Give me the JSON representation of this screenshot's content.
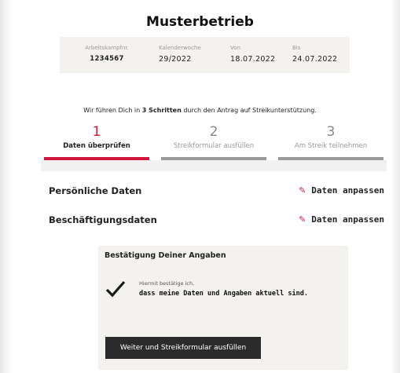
{
  "company_name": "Musterbetrieb",
  "info": {
    "arbeitskampf_label": "Arbeitskampfnr.",
    "arbeitskampf_value": "1234567",
    "kalenderwoche_label": "Kalenderwoche",
    "kalenderwoche_value": "29/2022",
    "von_label": "Von",
    "von_value": "18.07.2022",
    "bis_label": "Bis",
    "bis_value": "24.07.2022"
  },
  "intro": {
    "before": "Wir führen Dich in ",
    "bold": "3 Schritten",
    "after": " durch den Antrag auf Streikunterstützung."
  },
  "steps": [
    {
      "number": "1",
      "label": "Daten überprüfen",
      "active": true
    },
    {
      "number": "2",
      "label": "Streikformular ausfüllen",
      "active": false
    },
    {
      "number": "3",
      "label": "Am Streik teilnehmen",
      "active": false
    }
  ],
  "sections": [
    {
      "label": "Persönliche Daten",
      "edit_label": "Daten anpassen"
    },
    {
      "label": "Beschäftigungsdaten",
      "edit_label": "Daten anpassen"
    }
  ],
  "confirmation": {
    "heading": "Bestätigung Deiner Angaben",
    "small_text": "Hiermit bestätige ich,",
    "main_text": "dass meine Daten und Angaben aktuell sind.",
    "checked": true,
    "button_label": "Weiter und Streikformular ausfüllen"
  },
  "colors": {
    "accent": "#d1163a",
    "panel": "#f4f2ee",
    "button": "#2b2b2b"
  },
  "icons": {
    "edit": "pencil-icon",
    "check": "checkmark-icon"
  }
}
